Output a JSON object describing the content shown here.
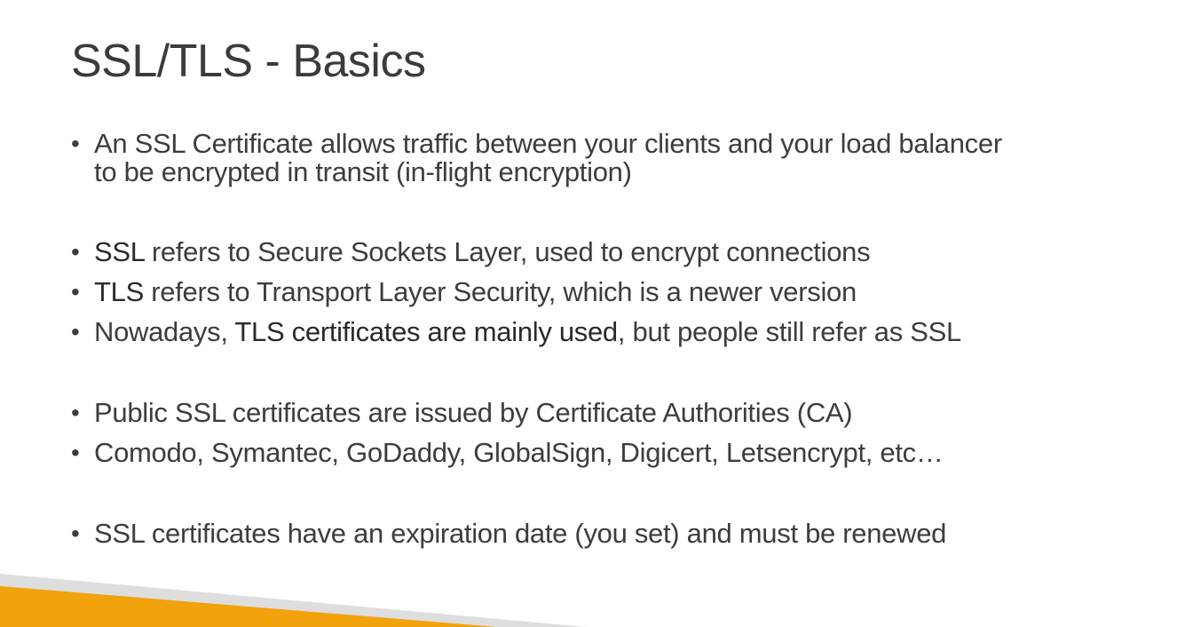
{
  "slide": {
    "title": "SSL/TLS - Basics",
    "bullet_glyph": "•",
    "bullets": [
      {
        "text_a": "An SSL Certificate allows traffic between your clients and your load balancer",
        "text_b": "to be encrypted in transit (in-flight encryption)"
      },
      {
        "strong": "SSL",
        "rest": " refers to Secure Sockets Layer, used to encrypt connections"
      },
      {
        "strong": "TLS",
        "rest": " refers to Transport Layer Security, which is a newer version"
      },
      {
        "pre": "Nowadays, ",
        "strong": "TLS certificates are mainly used",
        "rest": ", but people still refer as SSL"
      },
      {
        "text": "Public SSL certificates are issued by Certificate Authorities (CA)"
      },
      {
        "text": "Comodo, Symantec, GoDaddy, GlobalSign, Digicert, Letsencrypt, etc…"
      },
      {
        "text": "SSL certificates have an expiration date (you set) and must be renewed"
      }
    ]
  },
  "colors": {
    "accent_orange": "#f2a20c",
    "accent_gray": "#d9d9d9",
    "text": "#3d3d3d"
  }
}
